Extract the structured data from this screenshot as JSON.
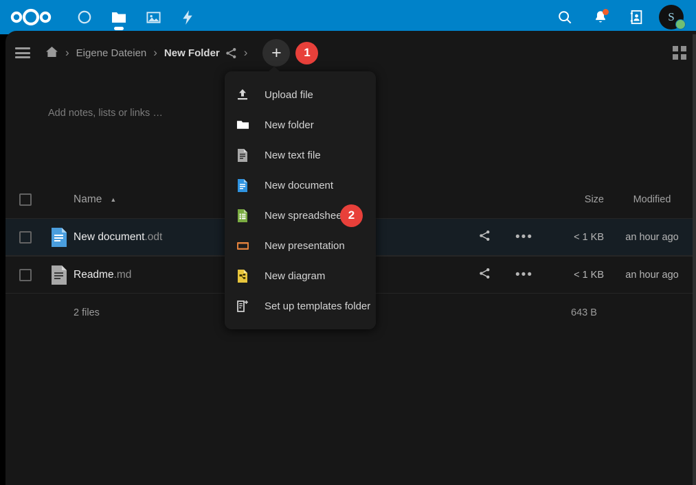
{
  "topbar": {
    "logo_name": "nextcloud-logo",
    "accent_color": "#0082c9",
    "nav": [
      {
        "icon": "dashboard-icon",
        "label": "Dashboard",
        "active": false
      },
      {
        "icon": "files-icon",
        "label": "Files",
        "active": true
      },
      {
        "icon": "photos-icon",
        "label": "Photos",
        "active": false
      },
      {
        "icon": "activity-icon",
        "label": "Activity",
        "active": false
      }
    ],
    "right": [
      {
        "icon": "search-icon",
        "label": "Search"
      },
      {
        "icon": "bell-icon",
        "label": "Notifications",
        "badge": true,
        "badge_color": "#f25f2a"
      },
      {
        "icon": "contacts-icon",
        "label": "Contacts"
      }
    ],
    "avatar": {
      "initial": "S",
      "status": "online",
      "status_color": "#6fbf73"
    }
  },
  "breadcrumb": {
    "menu_icon": "hamburger-icon",
    "home_icon": "home-icon",
    "separator": "›",
    "items": [
      {
        "label": "Eigene Dateien",
        "current": false
      },
      {
        "label": "New Folder",
        "current": true
      }
    ],
    "share_icon": "share-icon",
    "new_button_label": "+",
    "step_badge_1": "1",
    "badge_color": "#e8403a",
    "grid_toggle_icon": "grid-view-icon"
  },
  "notes": {
    "placeholder": "Add notes, lists or links …"
  },
  "filelist": {
    "columns": {
      "name": "Name",
      "size": "Size",
      "modified": "Modified"
    },
    "sort_caret": "▲",
    "rows": [
      {
        "icon": "document-file-icon",
        "icon_color": "#4a9ede",
        "name": "New document",
        "ext": ".odt",
        "share_icon": "share-icon",
        "menu_icon": "•••",
        "size": "< 1 KB",
        "modified": "an hour ago",
        "selected": true
      },
      {
        "icon": "text-file-icon",
        "icon_color": "#a8a8a8",
        "name": "Readme",
        "ext": ".md",
        "share_icon": "share-icon",
        "menu_icon": "•••",
        "size": "< 1 KB",
        "modified": "an hour ago",
        "selected": false
      }
    ],
    "footer": {
      "files_count": "2 files",
      "total_size": "643 B"
    }
  },
  "new_menu": {
    "items": [
      {
        "label": "Upload file",
        "icon": "upload-icon"
      },
      {
        "label": "New folder",
        "icon": "folder-icon"
      },
      {
        "label": "New text file",
        "icon": "text-file-icon"
      },
      {
        "label": "New document",
        "icon": "document-icon"
      },
      {
        "label": "New spreadsheet",
        "icon": "spreadsheet-icon",
        "step_badge": "2"
      },
      {
        "label": "New presentation",
        "icon": "presentation-icon"
      },
      {
        "label": "New diagram",
        "icon": "diagram-icon"
      },
      {
        "label": "Set up templates folder",
        "icon": "templates-folder-icon"
      }
    ]
  }
}
